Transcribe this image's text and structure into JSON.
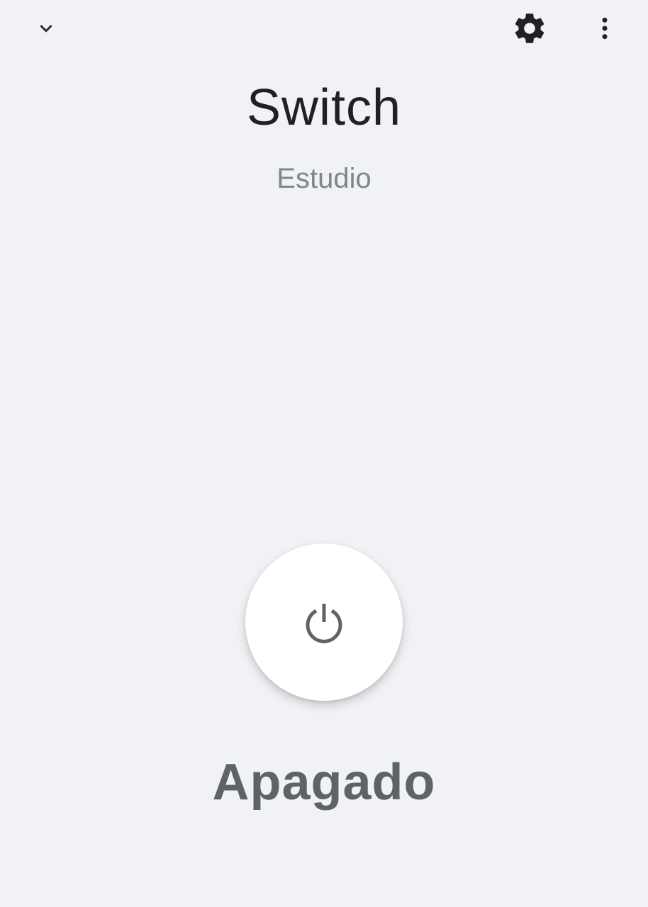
{
  "header": {
    "back_icon": "chevron-down-icon",
    "settings_icon": "gear-icon",
    "more_icon": "more-vert-icon"
  },
  "device": {
    "name": "Switch",
    "room": "Estudio",
    "state": "Apagado"
  },
  "power_button": {
    "icon": "power-icon",
    "icon_color": "#5f6368"
  },
  "colors": {
    "background": "#f1f2f5",
    "title": "#202124",
    "subtitle": "#80868b",
    "state": "#5f6368"
  }
}
